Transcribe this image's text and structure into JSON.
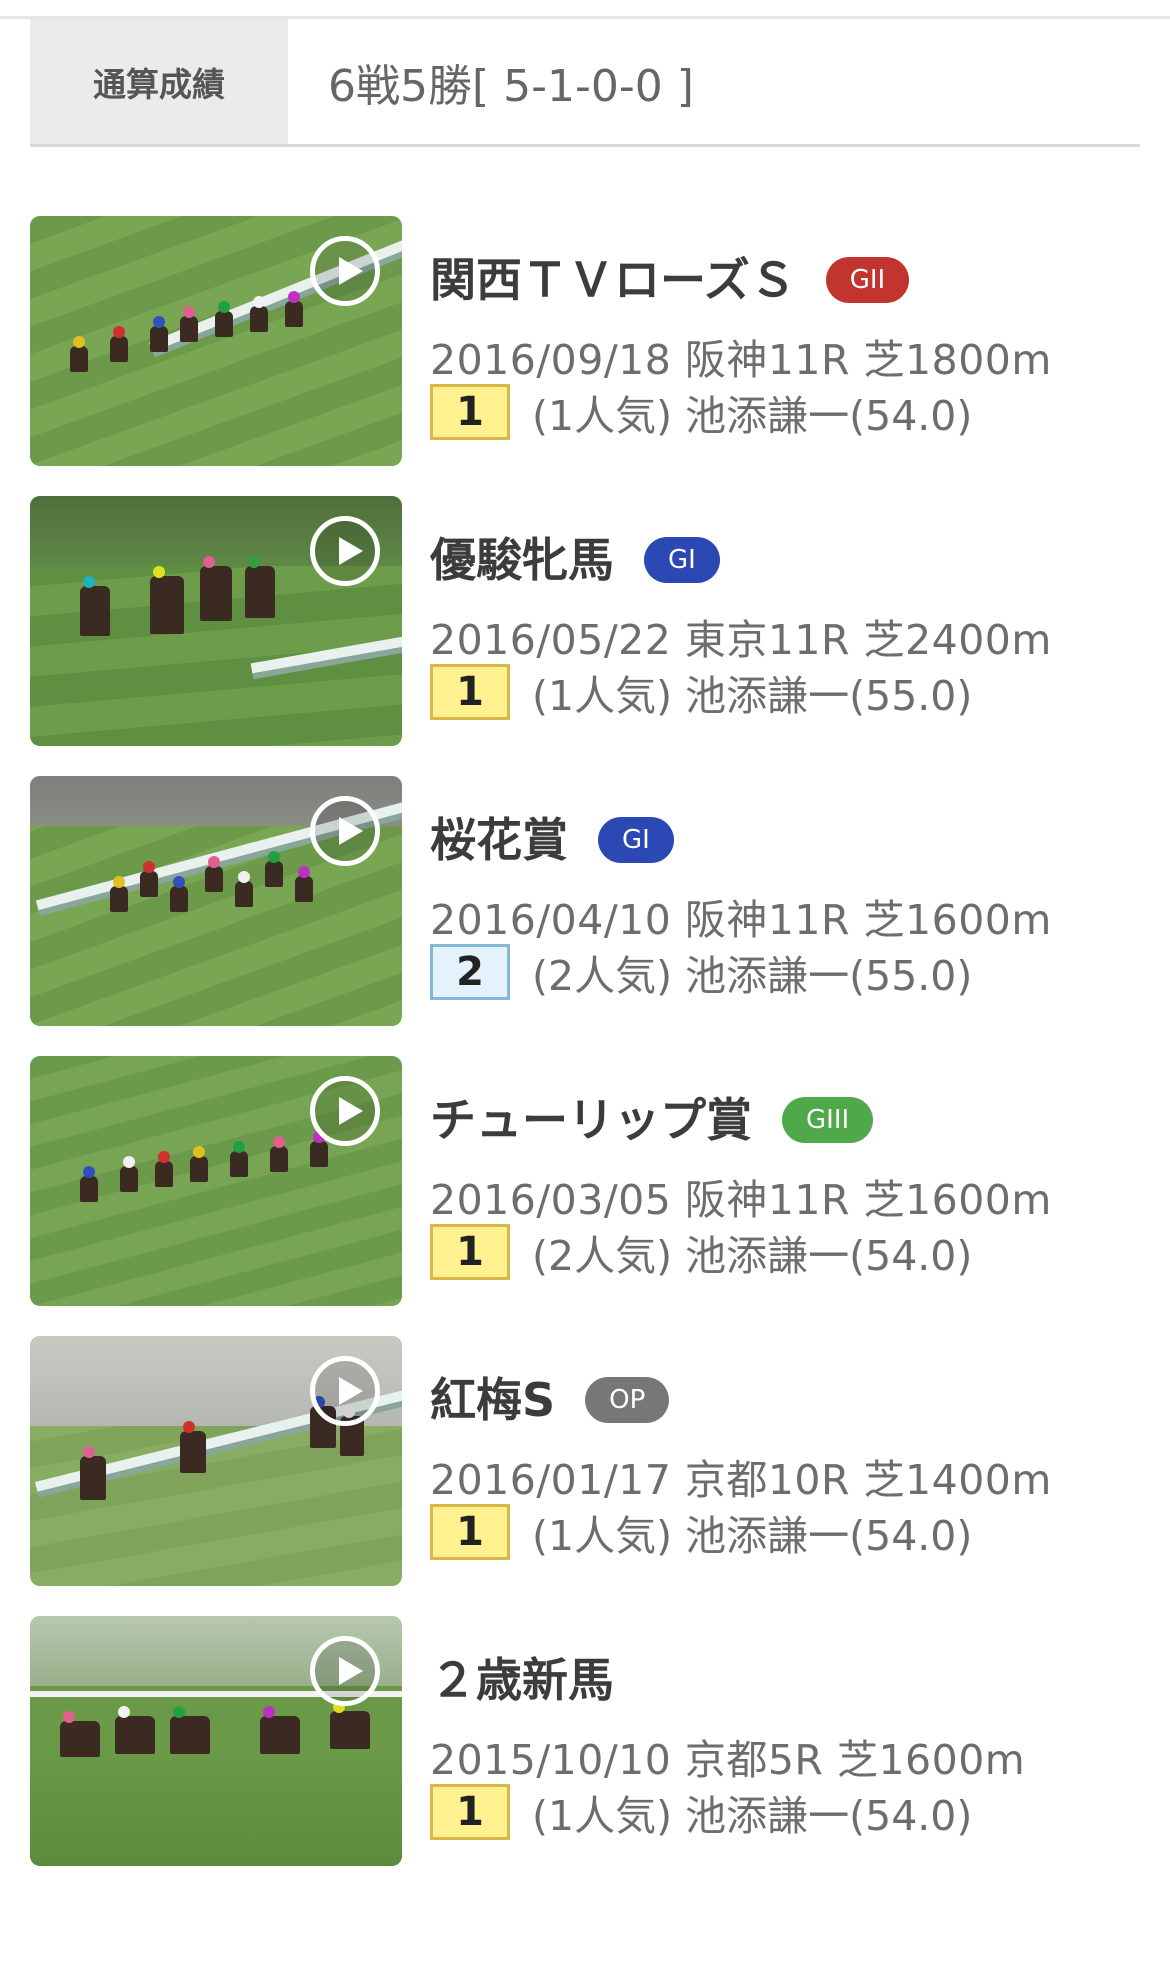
{
  "summary": {
    "label": "通算成績",
    "value": "6戦5勝[ 5-1-0-0 ]"
  },
  "colors": {
    "GII": "#c1352e",
    "GI": "#2b48b4",
    "GIII": "#4fa94a",
    "OP": "#777777",
    "rank_first_bg": "#fff18f",
    "rank_second_bg": "#e4f3fb"
  },
  "races": [
    {
      "name": "関西ＴＶローズＳ",
      "grade": "GII",
      "date_course": "2016/09/18 阪神11R 芝1800m",
      "rank": "1",
      "detail": "(1人気) 池添謙一(54.0)",
      "play_icon": "play-icon"
    },
    {
      "name": "優駿牝馬",
      "grade": "GI",
      "date_course": "2016/05/22 東京11R 芝2400m",
      "rank": "1",
      "detail": "(1人気) 池添謙一(55.0)",
      "play_icon": "play-icon"
    },
    {
      "name": "桜花賞",
      "grade": "GI",
      "date_course": "2016/04/10 阪神11R 芝1600m",
      "rank": "2",
      "detail": "(2人気) 池添謙一(55.0)",
      "play_icon": "play-icon"
    },
    {
      "name": "チューリップ賞",
      "grade": "GIII",
      "date_course": "2016/03/05 阪神11R 芝1600m",
      "rank": "1",
      "detail": "(2人気) 池添謙一(54.0)",
      "play_icon": "play-icon"
    },
    {
      "name": "紅梅S",
      "grade": "OP",
      "date_course": "2016/01/17 京都10R 芝1400m",
      "rank": "1",
      "detail": "(1人気) 池添謙一(54.0)",
      "play_icon": "play-icon"
    },
    {
      "name": "２歳新馬",
      "grade": "",
      "date_course": "2015/10/10 京都5R 芝1600m",
      "rank": "1",
      "detail": "(1人気) 池添謙一(54.0)",
      "play_icon": "play-icon"
    }
  ]
}
